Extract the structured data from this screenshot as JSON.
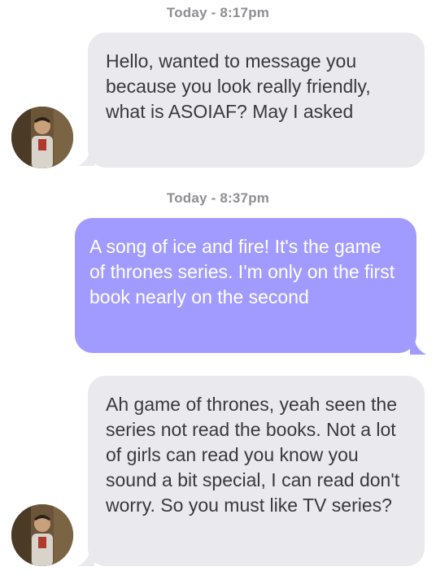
{
  "thread": {
    "timestamps": [
      "Today - 8:17pm",
      "Today - 8:37pm"
    ],
    "messages": [
      {
        "direction": "received",
        "text": "Hello, wanted to message you because you look really friendly, what is ASOIAF? May I asked"
      },
      {
        "direction": "sent",
        "text": "A song of ice and fire! It's the game of thrones series. I'm only on the first book nearly on the second"
      },
      {
        "direction": "received",
        "text": "Ah game of thrones, yeah seen the series not read the books. Not a lot of girls can read you know you sound a bit special, I can read don't worry. So you must like TV series?"
      }
    ]
  },
  "colors": {
    "received_bubble": "#e9e9ee",
    "sent_bubble": "#a29bff",
    "timestamp_text": "#8e8e93"
  },
  "icons": {
    "avatar": "user-avatar-photo"
  }
}
